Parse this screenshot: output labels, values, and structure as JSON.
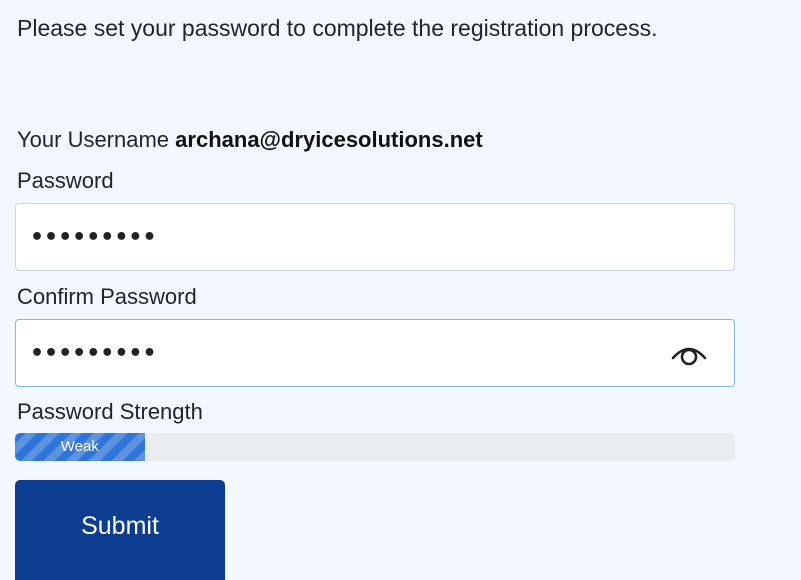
{
  "intro_text": "Please set your password to complete the registration process.",
  "username": {
    "label": "Your Username",
    "value": "archana@dryicesolutions.net"
  },
  "password_field": {
    "label": "Password",
    "value": "•••••••••"
  },
  "confirm_field": {
    "label": "Confirm Password",
    "value": "•••••••••",
    "toggle_icon": "eye-icon"
  },
  "strength": {
    "label": "Password Strength",
    "level_text": "Weak",
    "level_fraction": 0.18,
    "color": "#2f74d8"
  },
  "submit_label": "Submit",
  "colors": {
    "background": "#f2f8fd",
    "button": "#0d3d91"
  }
}
